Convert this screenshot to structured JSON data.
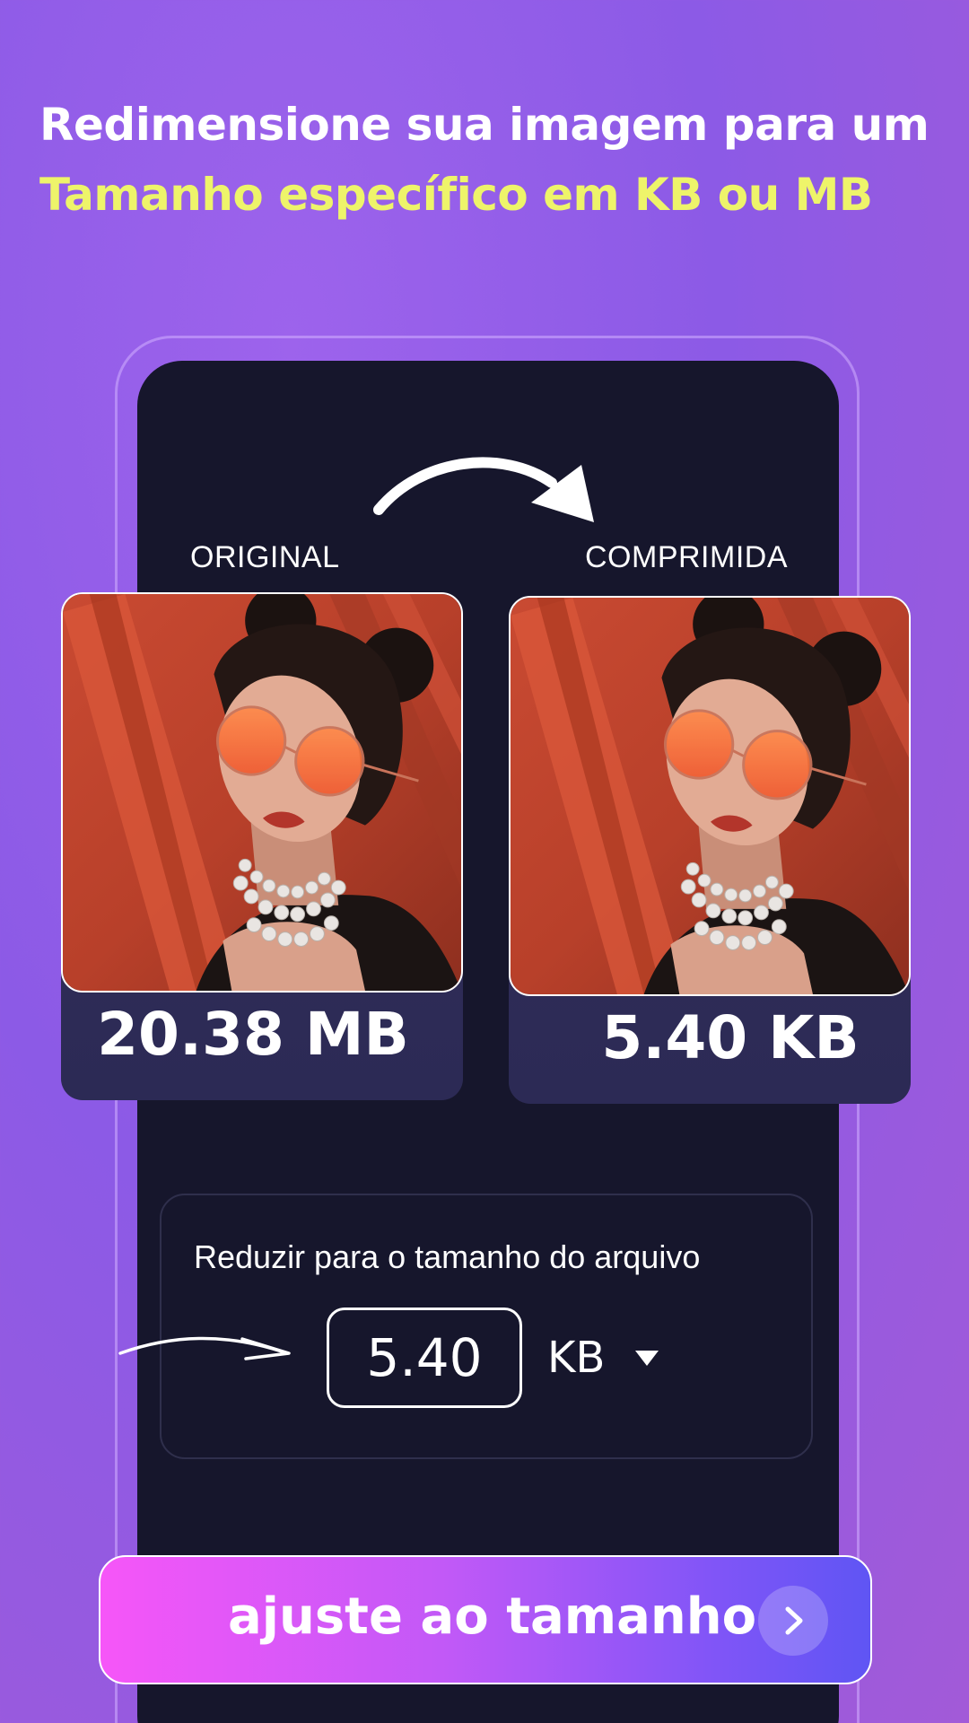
{
  "header": {
    "line1": "Redimensione sua imagem para um",
    "line2": "Tamanho específico em KB ou MB"
  },
  "comparison": {
    "original": {
      "label": "ORIGINAL",
      "size": "20.38 MB"
    },
    "compressed": {
      "label": "COMPRIMIDA",
      "size": "5.40 KB"
    }
  },
  "reduce": {
    "label": "Reduzir para o tamanho do arquivo",
    "value": "5.40",
    "unit": "KB"
  },
  "cta": {
    "label": "ajuste ao tamanho"
  },
  "colors": {
    "background": "#9a62ea",
    "highlight_text": "#eef46a",
    "panel": "#16162c",
    "card": "#2f2c58",
    "cta_start": "#f656f8",
    "cta_end": "#5f55f4"
  },
  "icons": {
    "curved_arrow": "curved-arrow-icon",
    "pointer_arrow": "pointer-arrow-icon",
    "dropdown": "caret-down-icon",
    "cta": "chevron-right-icon"
  }
}
